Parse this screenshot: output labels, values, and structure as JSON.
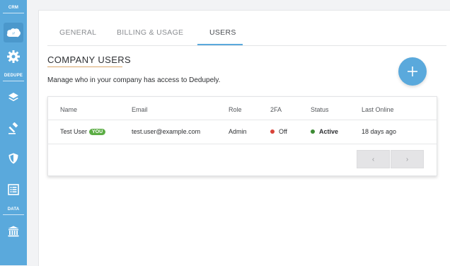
{
  "sidebar": {
    "sections": {
      "crm": "CRM",
      "dedupe": "DEDUPE",
      "data": "DATA"
    },
    "items": [
      {
        "icon": "salesforce-cloud-icon",
        "active": true
      },
      {
        "icon": "gear-icon"
      },
      {
        "icon": "layers-icon"
      },
      {
        "icon": "hammer-icon"
      },
      {
        "icon": "shield-icon"
      },
      {
        "icon": "list-icon"
      },
      {
        "icon": "bank-icon"
      }
    ]
  },
  "tabs": [
    {
      "label": "GENERAL"
    },
    {
      "label": "BILLING & USAGE"
    },
    {
      "label": "USERS",
      "active": true
    }
  ],
  "section": {
    "title": "COMPANY USERS",
    "subtitle": "Manage who in your company has access to Dedupely.",
    "add_label": "+"
  },
  "table": {
    "headers": {
      "name": "Name",
      "email": "Email",
      "role": "Role",
      "twofa": "2FA",
      "status": "Status",
      "last_online": "Last Online"
    },
    "rows": [
      {
        "name": "Test User",
        "badge": "YOU",
        "email": "test.user@example.com",
        "role": "Admin",
        "twofa": "Off",
        "status": "Active",
        "last_online": "18 days ago"
      }
    ],
    "pagination": {
      "prev": "‹",
      "next": "›"
    }
  },
  "colors": {
    "accent": "#5aa9dc",
    "off": "#d9443a",
    "active": "#3d8b34",
    "badge": "#5cad45"
  }
}
